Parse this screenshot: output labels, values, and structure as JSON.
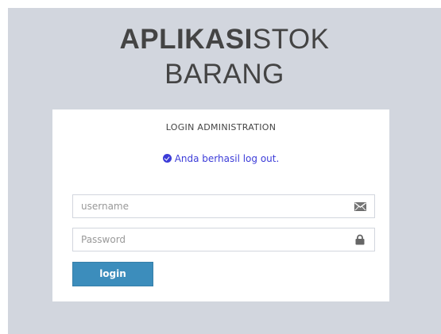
{
  "app": {
    "title_bold": "APLIKASI",
    "title_light": "STOK",
    "title_line2": "BARANG"
  },
  "login": {
    "heading": "LOGIN ADMINISTRATION",
    "status_message": "Anda berhasil log out.",
    "username_placeholder": "username",
    "username_value": "",
    "password_placeholder": "Password",
    "password_value": "",
    "button_label": "login"
  },
  "colors": {
    "background": "#d2d6de",
    "primary": "#3c8dbc",
    "message": "#3c3cd8",
    "title": "#444444"
  },
  "icons": {
    "status": "check-circle-icon",
    "username": "envelope-icon",
    "password": "lock-icon"
  }
}
